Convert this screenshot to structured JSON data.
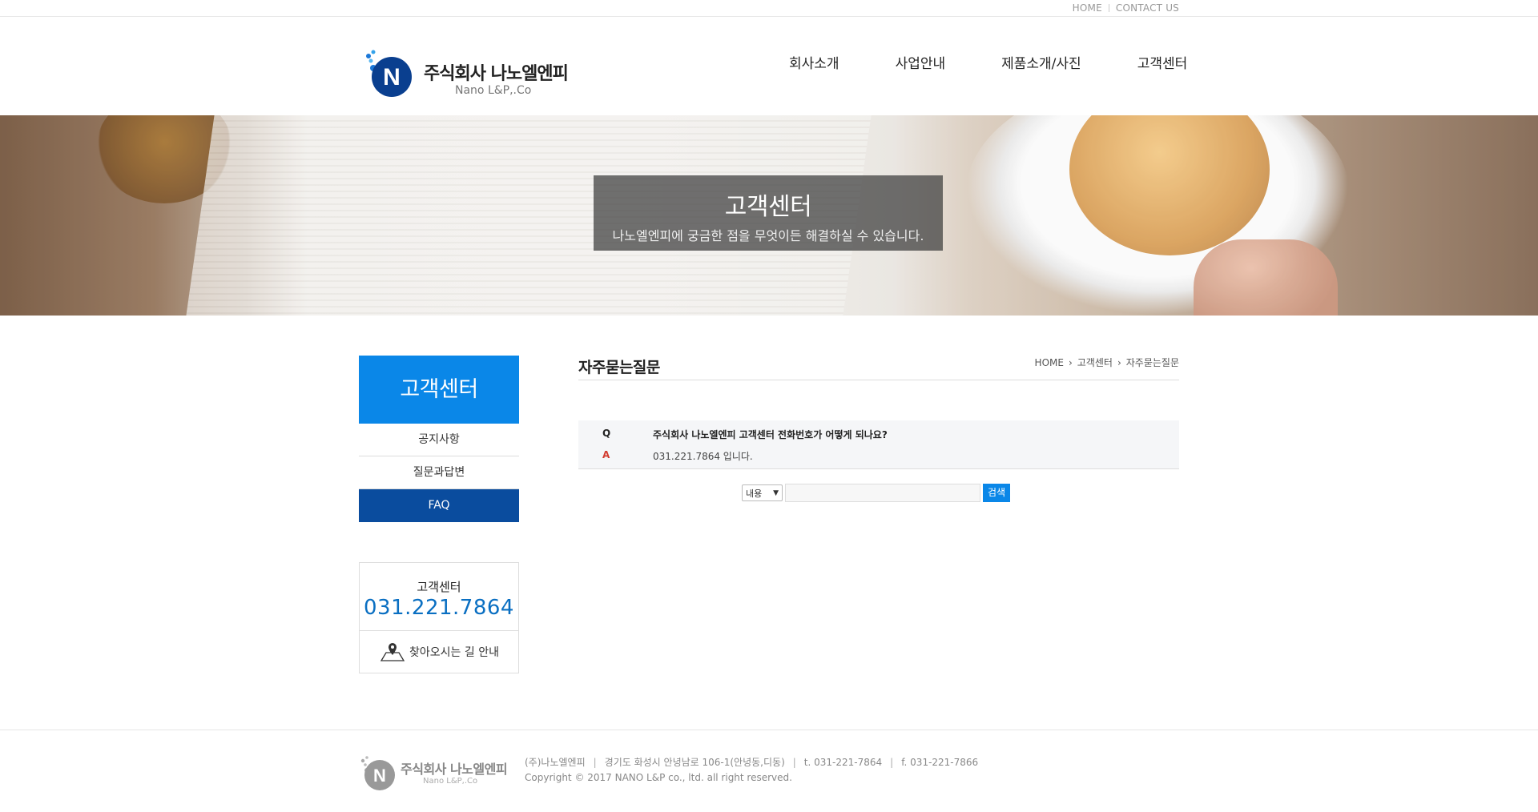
{
  "topbar": {
    "home": "HOME",
    "contact": "CONTACT US"
  },
  "logo": {
    "title": "주식회사 나노엘엔피",
    "sub": "Nano L&P,.Co",
    "mark_letter": "N"
  },
  "nav": [
    {
      "label": "회사소개"
    },
    {
      "label": "사업안내"
    },
    {
      "label": "제품소개/사진"
    },
    {
      "label": "고객센터"
    }
  ],
  "hero": {
    "title": "고객센터",
    "sub": "나노엘엔피에 궁금한 점을 무엇이든 해결하실 수 있습니다."
  },
  "sidebar": {
    "title": "고객센터",
    "items": [
      {
        "label": "공지사항",
        "active": false
      },
      {
        "label": "질문과답변",
        "active": false
      },
      {
        "label": "FAQ",
        "active": true
      }
    ],
    "cs_label": "고객센터",
    "cs_phone": "031.221.7864",
    "map_label": "찾아오시는 길 안내"
  },
  "content": {
    "title": "자주묻는질문",
    "breadcrumb": [
      "HOME",
      "고객센터",
      "자주묻는질문"
    ]
  },
  "faq": {
    "q_mark": "Q",
    "question": "주식회사 나노엘엔피 고객센터 전화번호가 어떻게 되나요?",
    "a_mark": "A",
    "answer": "031.221.7864 입니다."
  },
  "search": {
    "select_value": "내용",
    "input_value": "",
    "button": "검색"
  },
  "footer": {
    "logo_title": "주식회사 나노엘엔피",
    "logo_sub": "Nano L&P,.Co",
    "company": "(주)나노엘엔피",
    "address": "경기도 화성시 안녕남로 106-1(안녕동,디동)",
    "tel": "t. 031-221-7864",
    "fax": "f. 031-221-7866",
    "copyright": "Copyright © 2017 NANO L&P co., ltd. all right reserved."
  },
  "colors": {
    "accent": "#0a87e8",
    "active_menu": "#0a4c9e",
    "phone": "#0a6fc2",
    "answer_mark": "#d23b2f"
  }
}
